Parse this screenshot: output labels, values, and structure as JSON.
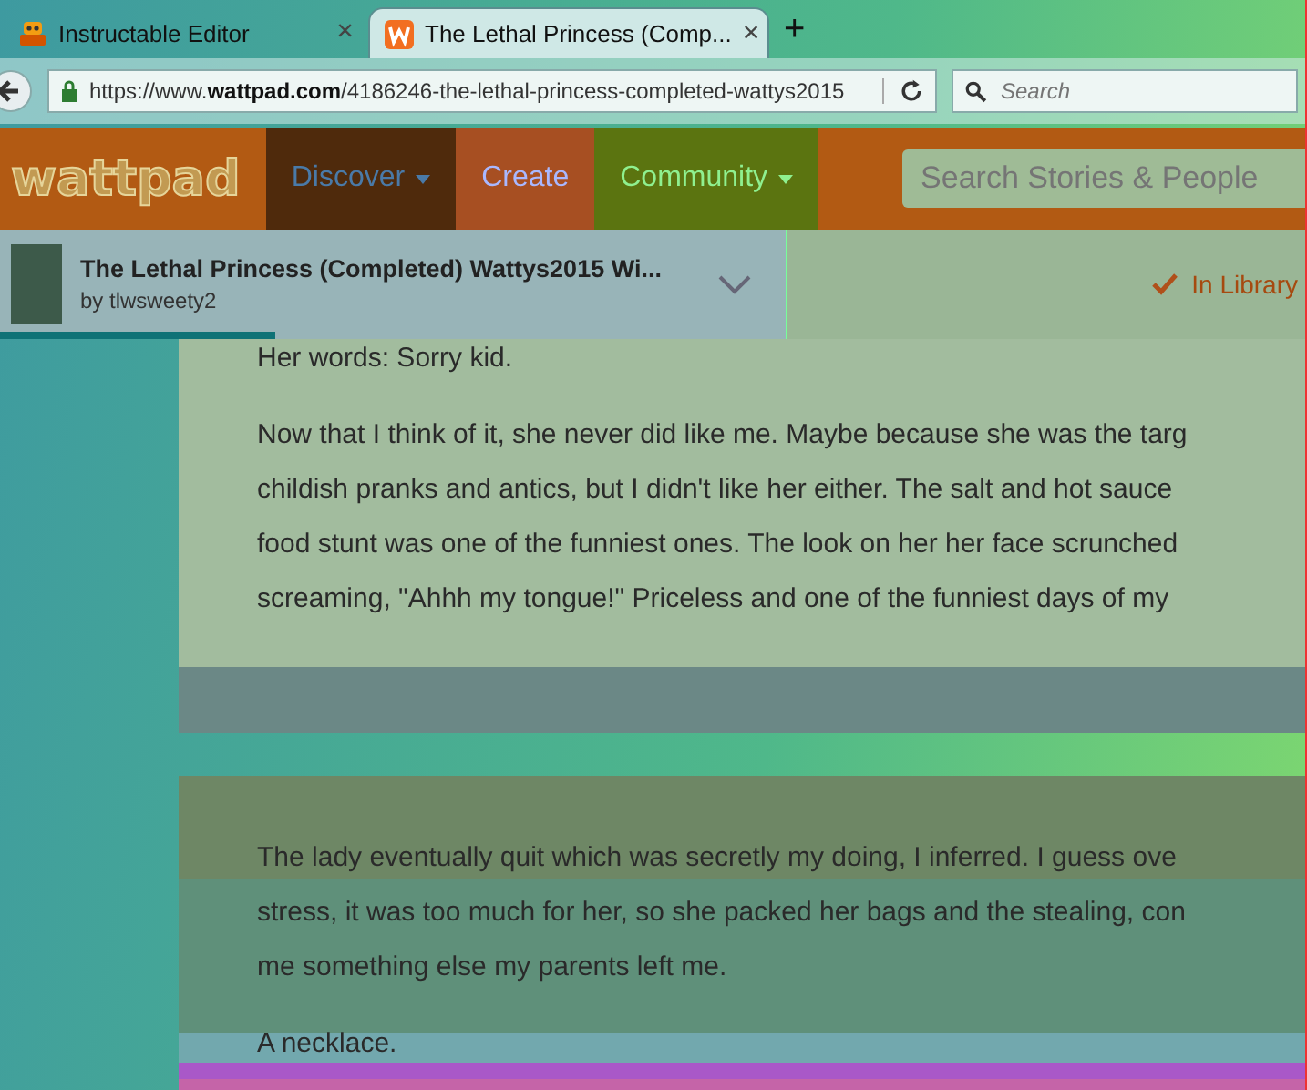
{
  "browser": {
    "tabs": [
      {
        "title": "Instructable Editor",
        "selected": false,
        "close": "×"
      },
      {
        "title": "The Lethal Princess (Comp...",
        "selected": true,
        "close": "×"
      }
    ],
    "new_tab": "+",
    "url_host": "https://www.",
    "url_domain": "wattpad.com",
    "url_path": "/4186246-the-lethal-princess-completed-wattys2015",
    "search": {
      "placeholder": "Search"
    }
  },
  "nav": {
    "logo": "wattpad",
    "items": [
      {
        "label": "Discover",
        "dropdown": true,
        "color": "#4f2a0c"
      },
      {
        "label": "Create",
        "dropdown": false,
        "color": "#a74f22"
      },
      {
        "label": "Community",
        "dropdown": true,
        "color": "#5b7410"
      }
    ],
    "search": {
      "placeholder": "Search Stories & People"
    }
  },
  "story": {
    "title": "The Lethal Princess (Completed) Wattys2015 Wi...",
    "author": "by tlwsweety2",
    "progress": {
      "level": 0.35
    },
    "library": "In Library"
  },
  "sections": [
    {
      "paragraphs": [
        {
          "lines": [
            "Her words: Sorry kid."
          ]
        },
        {
          "lines": [
            "Now that I think of it, she never did like me. Maybe because she was the targ",
            "childish pranks and antics, but I didn't like her either. The salt and hot sauce",
            "food stunt was one of the funniest ones. The look on her her face scrunched",
            "screaming, \"Ahhh my tongue!\" Priceless and one of the funniest days of my"
          ]
        }
      ]
    },
    {
      "paragraphs": [
        {
          "lines": [
            "The lady eventually quit which was secretly my doing, I inferred. I guess ove",
            "stress, it was too much for her, so she packed her bags and the stealing, con",
            "me something else my parents left me."
          ]
        },
        {
          "lines": [
            "A necklace."
          ]
        }
      ]
    }
  ]
}
